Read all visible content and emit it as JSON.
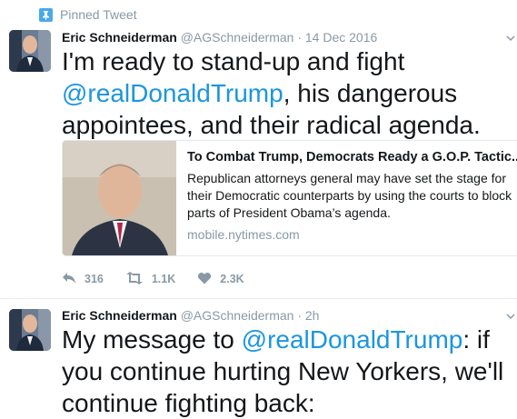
{
  "pinned_label": "Pinned Tweet",
  "colors": {
    "link": "#1b95e0",
    "muted": "#8899a6",
    "pin": "#4aa8eb"
  },
  "tweets": [
    {
      "name": "Eric Schneiderman",
      "handle": "@AGSchneiderman",
      "separator": "·",
      "time": "14 Dec 2016",
      "text_1": "I'm ready to stand-up and fight",
      "mention": "@realDonaldTrump",
      "text_2": ", his dangerous appointees, and their radical agenda.",
      "card": {
        "title": "To Combat Trump, Democrats Ready a G.O.P. Tactic...",
        "description": "Republican attorneys general may have set the stage for their Democratic counterparts by using the courts to block parts of President Obama’s agenda.",
        "domain": "mobile.nytimes.com"
      },
      "actions": {
        "replies": "316",
        "retweets": "1.1K",
        "likes": "2.3K"
      }
    },
    {
      "name": "Eric Schneiderman",
      "handle": "@AGSchneiderman",
      "separator": "·",
      "time": "2h",
      "text_1": "My message to ",
      "mention": "@realDonaldTrump",
      "text_2": ": if you continue hurting New Yorkers, we'll continue fighting back:"
    }
  ],
  "icons": [
    "pin-icon",
    "chevron-down-icon",
    "reply-icon",
    "retweet-icon",
    "like-icon"
  ]
}
